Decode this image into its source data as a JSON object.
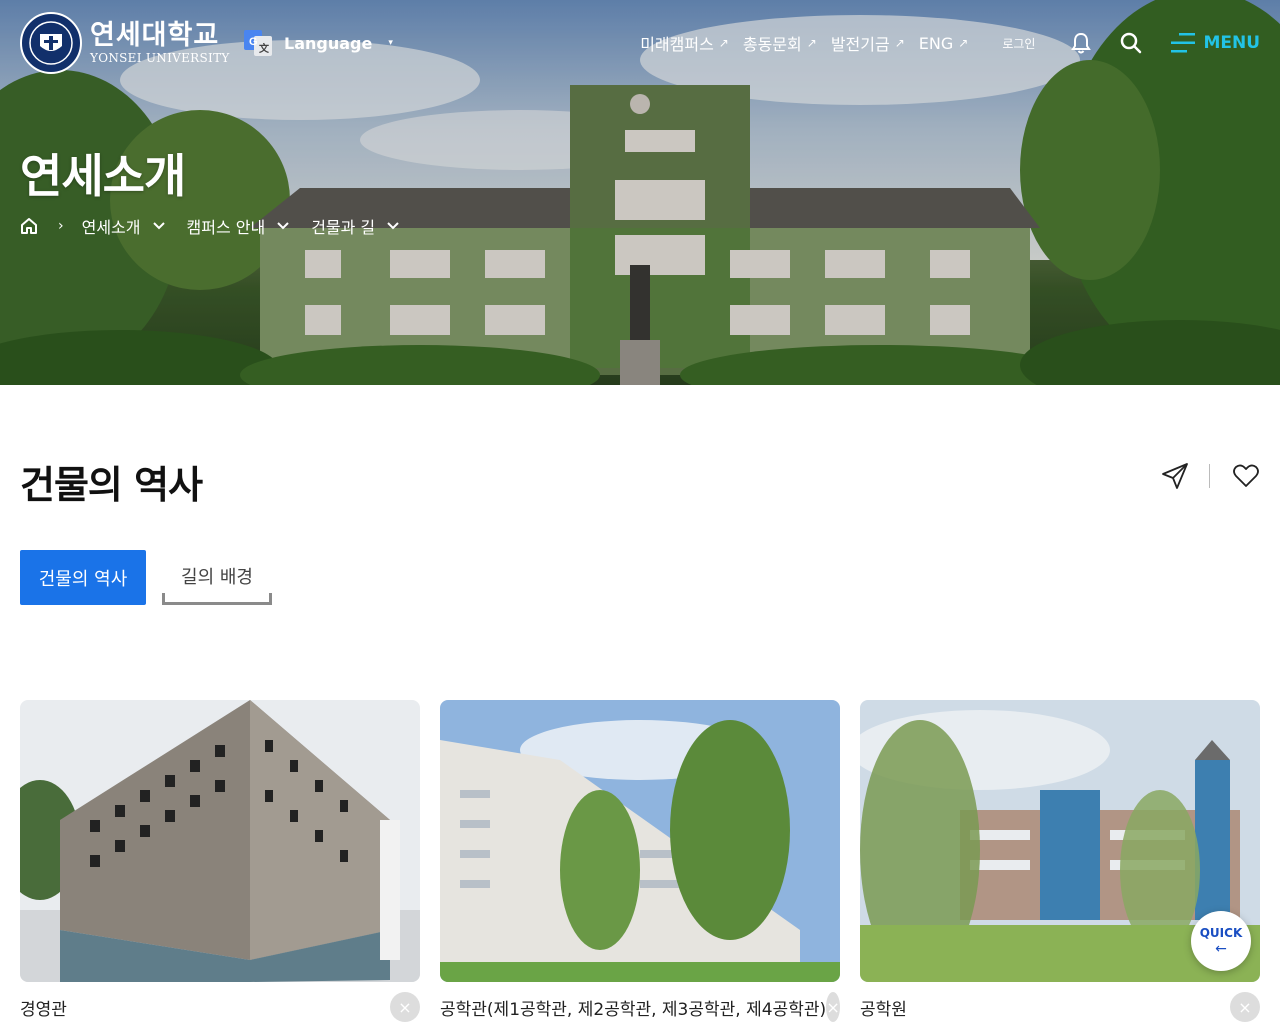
{
  "header": {
    "logo": {
      "name_ko": "연세대학교",
      "name_en": "YONSEI UNIVERSITY",
      "seal_text": "YONSEI UNIVERSITY"
    },
    "language": {
      "label": "Language",
      "caret": "▾"
    },
    "nav": [
      {
        "label": "미래캠퍼스",
        "arrow": "↗"
      },
      {
        "label": "총동문회",
        "arrow": "↗"
      },
      {
        "label": "발전기금",
        "arrow": "↗"
      },
      {
        "label": "ENG",
        "arrow": "↗"
      }
    ],
    "login": "로그인",
    "menu": "MENU"
  },
  "hero": {
    "title": "연세소개",
    "breadcrumbs": [
      "연세소개",
      "캠퍼스 안내",
      "건물과 길"
    ],
    "separator": "›"
  },
  "page": {
    "title": "건물의 역사",
    "tabs": [
      {
        "label": "건물의 역사",
        "active": true
      },
      {
        "label": "길의 배경",
        "active": false
      }
    ]
  },
  "cards": [
    {
      "name": "경영관",
      "close": "×"
    },
    {
      "name": "공학관(제1공학관, 제2공학관, 제3공학관, 제4공학관)",
      "close": "×"
    },
    {
      "name": "공학원",
      "close": "×"
    }
  ],
  "quick": {
    "label": "QUICK",
    "arrow": "←"
  },
  "colors": {
    "accent": "#1a73e8",
    "menu": "#22c3e6",
    "quick": "#1a4ec2"
  }
}
